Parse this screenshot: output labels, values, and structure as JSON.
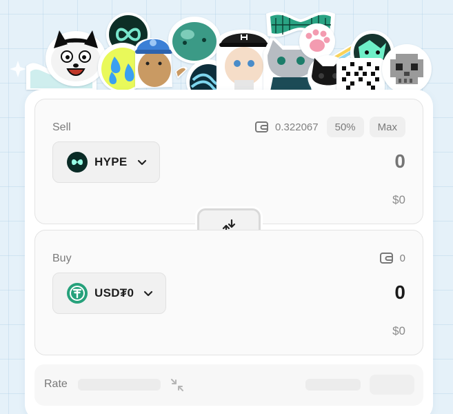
{
  "header": {
    "stickers": [
      "hype-logo-sticker",
      "cartoon-cat-sticker",
      "sweat-drops-sticker",
      "blue-cap-character-sticker",
      "teal-blob-sticker",
      "cap-character-sticker",
      "wave-ball-sticker",
      "armored-cat-sticker",
      "mesh-bow-sticker",
      "paw-sticker",
      "green-character-sticker",
      "black-cat-sticker",
      "pixel-pattern-sticker",
      "pixel-skull-sticker"
    ]
  },
  "sell": {
    "label": "Sell",
    "balance": "0.322067",
    "pct_50": "50%",
    "max": "Max",
    "token": "HYPE",
    "amount_placeholder": "0",
    "fiat": "$0"
  },
  "buy": {
    "label": "Buy",
    "balance": "0",
    "token": "USD₮0",
    "amount": "0",
    "fiat": "$0"
  },
  "rate": {
    "label": "Rate"
  },
  "colors": {
    "accent": "#97fce4",
    "hype_bg": "#0a2b26",
    "usdt": "#26a17b"
  }
}
